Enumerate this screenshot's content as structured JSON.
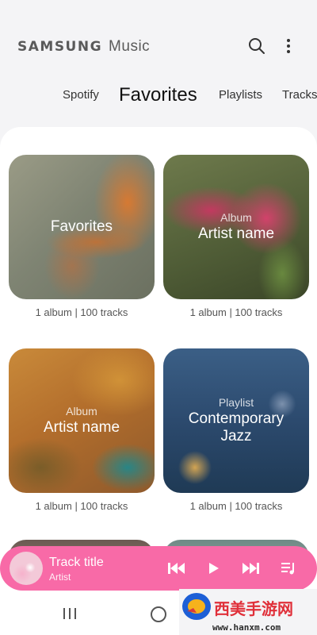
{
  "app": {
    "brand_primary": "SAMSUNG",
    "brand_secondary": "Music"
  },
  "tabs": [
    {
      "label": "Spotify",
      "active": false
    },
    {
      "label": "Favorites",
      "active": true
    },
    {
      "label": "Playlists",
      "active": false
    },
    {
      "label": "Tracks",
      "active": false
    }
  ],
  "cards": [
    {
      "kind": "",
      "title": "Favorites",
      "meta": "1 album  | 100 tracks"
    },
    {
      "kind": "Album",
      "title": "Artist name",
      "meta": "1 album  | 100 tracks"
    },
    {
      "kind": "Album",
      "title": "Artist name",
      "meta": "1 album  | 100 tracks"
    },
    {
      "kind": "Playlist",
      "title": "Contemporary Jazz",
      "meta": "1 album  | 100 tracks"
    }
  ],
  "player": {
    "track_title": "Track title",
    "artist": "Artist",
    "accent_color": "#f86aa7"
  },
  "watermark": {
    "line1": "西美手游网",
    "line2": "www.hanxm.com"
  },
  "icons": {
    "search": "search-icon",
    "more": "more-vertical-icon",
    "previous": "skip-previous-icon",
    "play": "play-icon",
    "next": "skip-next-icon",
    "queue": "queue-music-icon",
    "recents": "recents-icon",
    "home": "home-icon"
  }
}
